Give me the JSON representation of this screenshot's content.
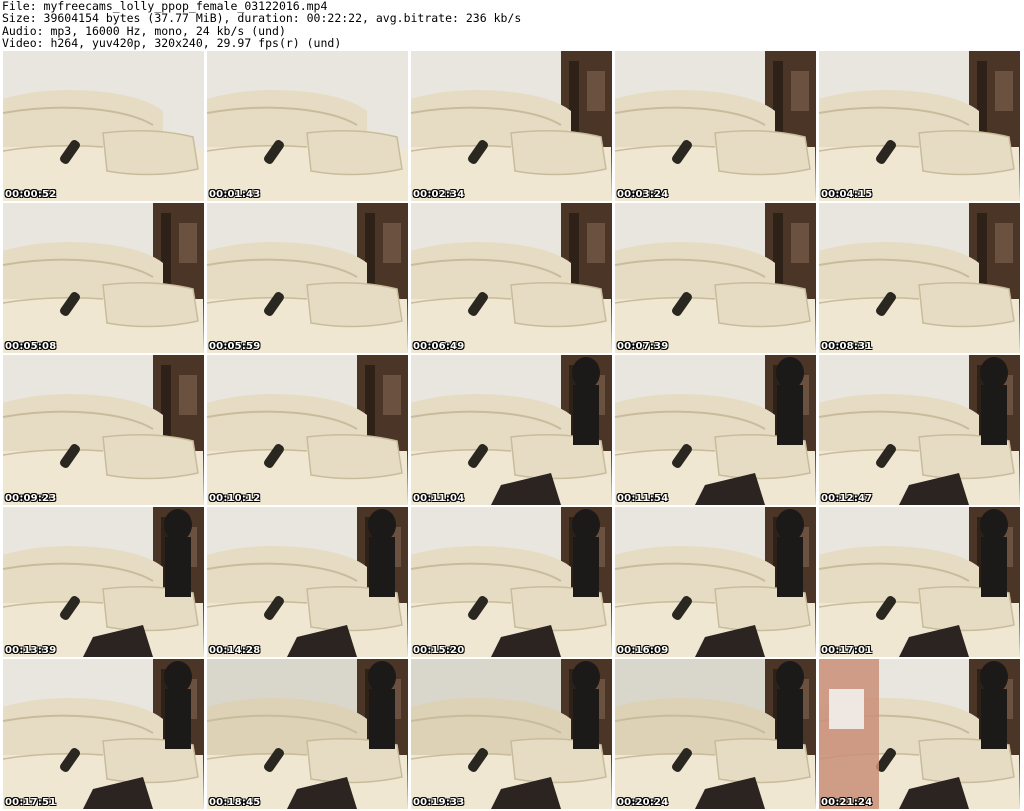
{
  "header": {
    "file": "File: myfreecams_lolly_ppop_female_03122016.mp4",
    "size": "Size: 39604154 bytes (37.77 MiB), duration: 00:22:22, avg.bitrate: 236 kb/s",
    "audio": "Audio: mp3, 16000 Hz, mono, 24 kb/s (und)",
    "video": "Video: h264, yuv420p, 320x240, 29.97 fps(r) (und)"
  },
  "thumbnails": [
    {
      "time": "00:00:52",
      "scene": "couch-left"
    },
    {
      "time": "00:01:43",
      "scene": "couch-left"
    },
    {
      "time": "00:02:34",
      "scene": "couch-shelf"
    },
    {
      "time": "00:03:24",
      "scene": "couch-shelf"
    },
    {
      "time": "00:04:15",
      "scene": "couch-shelf"
    },
    {
      "time": "00:05:08",
      "scene": "couch-shelf"
    },
    {
      "time": "00:05:59",
      "scene": "couch-shelf"
    },
    {
      "time": "00:06:49",
      "scene": "couch-shelf"
    },
    {
      "time": "00:07:39",
      "scene": "couch-shelf"
    },
    {
      "time": "00:08:31",
      "scene": "couch-shelf"
    },
    {
      "time": "00:09:23",
      "scene": "couch-shelf"
    },
    {
      "time": "00:10:12",
      "scene": "couch-shelf"
    },
    {
      "time": "00:11:04",
      "scene": "couch-wide"
    },
    {
      "time": "00:11:54",
      "scene": "couch-wide"
    },
    {
      "time": "00:12:47",
      "scene": "couch-wide"
    },
    {
      "time": "00:13:39",
      "scene": "couch-wide"
    },
    {
      "time": "00:14:28",
      "scene": "couch-wide"
    },
    {
      "time": "00:15:20",
      "scene": "couch-wide"
    },
    {
      "time": "00:16:09",
      "scene": "couch-wide"
    },
    {
      "time": "00:17:01",
      "scene": "couch-wide"
    },
    {
      "time": "00:17:51",
      "scene": "couch-wide"
    },
    {
      "time": "00:18:45",
      "scene": "couch-dim"
    },
    {
      "time": "00:19:33",
      "scene": "couch-dim"
    },
    {
      "time": "00:20:24",
      "scene": "couch-dim"
    },
    {
      "time": "00:21:24",
      "scene": "couch-person"
    }
  ],
  "colors": {
    "wall": "#e8e6df",
    "couch": "#e6dcc3",
    "couch_shadow": "#c9bc9c",
    "cushion": "#efe7d2",
    "shelf": "#4a3526",
    "object": "#2a2620",
    "floor": "#2b2420"
  }
}
